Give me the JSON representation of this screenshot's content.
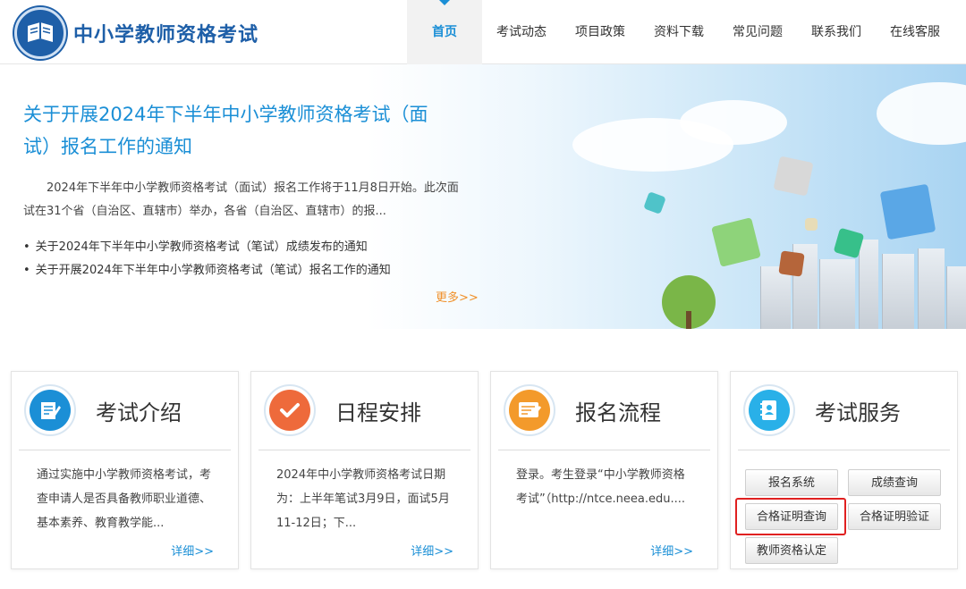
{
  "header": {
    "site_title": "中小学教师资格考试",
    "logo_icon": "book-emblem-icon",
    "nav": [
      {
        "label": "首页",
        "active": true
      },
      {
        "label": "考试动态",
        "active": false
      },
      {
        "label": "项目政策",
        "active": false
      },
      {
        "label": "资料下载",
        "active": false
      },
      {
        "label": "常见问题",
        "active": false
      },
      {
        "label": "联系我们",
        "active": false
      },
      {
        "label": "在线客服",
        "active": false
      }
    ]
  },
  "banner": {
    "headline_line1": "关于开展2024年下半年中小学教师资格考试（面",
    "headline_line2": "试）报名工作的通知",
    "summary": "2024年下半年中小学教师资格考试（面试）报名工作将于11月8日开始。此次面试在31个省（自治区、直辖市）举办，各省（自治区、直辖市）的报...",
    "links": [
      "关于2024年下半年中小学教师资格考试（笔试）成绩发布的通知",
      "关于开展2024年下半年中小学教师资格考试（笔试）报名工作的通知"
    ],
    "more": "更多>>"
  },
  "cards": [
    {
      "title": "考试介绍",
      "icon": "exam-document-icon",
      "body": "通过实施中小学教师资格考试，考查申请人是否具备教师职业道德、基本素养、教育教学能...",
      "more": "详细>>"
    },
    {
      "title": "日程安排",
      "icon": "checkmark-icon",
      "body": "2024年中小学教师资格考试日期为：上半年笔试3月9日，面试5月11-12日；下...",
      "more": "详细>>"
    },
    {
      "title": "报名流程",
      "icon": "registration-form-icon",
      "body": "登录。考生登录“中小学教师资格考试”（http://ntce.neea.edu....",
      "more": "详细>>"
    },
    {
      "title": "考试服务",
      "icon": "service-notebook-icon"
    }
  ],
  "services": [
    "报名系统",
    "成绩查询",
    "合格证明查询",
    "合格证明验证",
    "教师资格认定"
  ],
  "colors": {
    "brand": "#1e5fa8",
    "accent": "#1b8fd6",
    "more": "#f0902a",
    "highlight": "#e02020"
  }
}
